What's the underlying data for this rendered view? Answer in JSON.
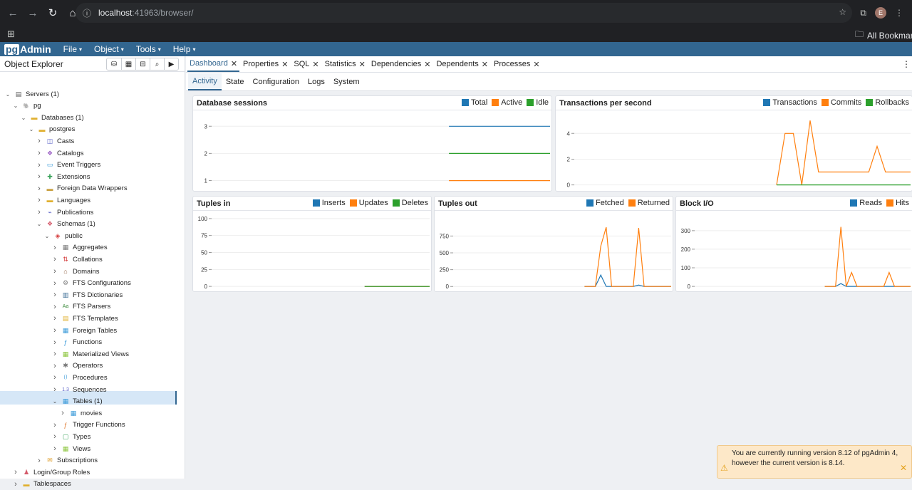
{
  "browser": {
    "url_host": "localhost",
    "url_rest": ":41963/browser/",
    "profile_initial": "E",
    "bookmarks_label": "All Bookmarks"
  },
  "menubar": {
    "logo_pg": "pg",
    "logo_admin": "Admin",
    "items": [
      "File",
      "Object",
      "Tools",
      "Help"
    ]
  },
  "explorer": {
    "title": "Object Explorer",
    "tree": [
      {
        "label": "Servers (1)",
        "level": 0,
        "toggle": "open",
        "icon": "servers-icon",
        "glyph": "▤",
        "color": "#555"
      },
      {
        "label": "pg",
        "level": 1,
        "toggle": "open",
        "icon": "server-elephant-icon",
        "glyph": "🐘",
        "color": "#326690"
      },
      {
        "label": "Databases (1)",
        "level": 2,
        "toggle": "open",
        "icon": "databases-icon",
        "glyph": "▬",
        "color": "#e0b030"
      },
      {
        "label": "postgres",
        "level": 3,
        "toggle": "open",
        "icon": "database-icon",
        "glyph": "▬",
        "color": "#e0b030"
      },
      {
        "label": "Casts",
        "level": 4,
        "toggle": "closed",
        "icon": "casts-icon",
        "glyph": "◫",
        "color": "#5a62c8"
      },
      {
        "label": "Catalogs",
        "level": 4,
        "toggle": "closed",
        "icon": "catalogs-icon",
        "glyph": "❖",
        "color": "#9b5fc4"
      },
      {
        "label": "Event Triggers",
        "level": 4,
        "toggle": "closed",
        "icon": "event-triggers-icon",
        "glyph": "▭",
        "color": "#3a9ad9"
      },
      {
        "label": "Extensions",
        "level": 4,
        "toggle": "closed",
        "icon": "extensions-icon",
        "glyph": "✚",
        "color": "#3aa35a"
      },
      {
        "label": "Foreign Data Wrappers",
        "level": 4,
        "toggle": "closed",
        "icon": "foreign-data-wrappers-icon",
        "glyph": "▬",
        "color": "#c9a040"
      },
      {
        "label": "Languages",
        "level": 4,
        "toggle": "closed",
        "icon": "languages-icon",
        "glyph": "▬",
        "color": "#e0b030"
      },
      {
        "label": "Publications",
        "level": 4,
        "toggle": "closed",
        "icon": "publications-icon",
        "glyph": "⌁",
        "color": "#5a62c8"
      },
      {
        "label": "Schemas (1)",
        "level": 4,
        "toggle": "open",
        "icon": "schemas-icon",
        "glyph": "❖",
        "color": "#d45a6a"
      },
      {
        "label": "public",
        "level": 5,
        "toggle": "open",
        "icon": "schema-public-icon",
        "glyph": "◈",
        "color": "#d43a3a"
      },
      {
        "label": "Aggregates",
        "level": 6,
        "toggle": "closed",
        "icon": "aggregates-icon",
        "glyph": "▦",
        "color": "#777"
      },
      {
        "label": "Collations",
        "level": 6,
        "toggle": "closed",
        "icon": "collations-icon",
        "glyph": "⇅",
        "color": "#d43a3a"
      },
      {
        "label": "Domains",
        "level": 6,
        "toggle": "closed",
        "icon": "domains-icon",
        "glyph": "⌂",
        "color": "#8a5a3a"
      },
      {
        "label": "FTS Configurations",
        "level": 6,
        "toggle": "closed",
        "icon": "fts-configurations-icon",
        "glyph": "⚙",
        "color": "#777"
      },
      {
        "label": "FTS Dictionaries",
        "level": 6,
        "toggle": "closed",
        "icon": "fts-dictionaries-icon",
        "glyph": "▥",
        "color": "#326690"
      },
      {
        "label": "FTS Parsers",
        "level": 6,
        "toggle": "closed",
        "icon": "fts-parsers-icon",
        "glyph": "Aa",
        "color": "#3a8a3a"
      },
      {
        "label": "FTS Templates",
        "level": 6,
        "toggle": "closed",
        "icon": "fts-templates-icon",
        "glyph": "▤",
        "color": "#e0b030"
      },
      {
        "label": "Foreign Tables",
        "level": 6,
        "toggle": "closed",
        "icon": "foreign-tables-icon",
        "glyph": "▦",
        "color": "#3a9ad9"
      },
      {
        "label": "Functions",
        "level": 6,
        "toggle": "closed",
        "icon": "functions-icon",
        "glyph": "ƒ",
        "color": "#3a9ad9"
      },
      {
        "label": "Materialized Views",
        "level": 6,
        "toggle": "closed",
        "icon": "materialized-views-icon",
        "glyph": "▦",
        "color": "#8ac43a"
      },
      {
        "label": "Operators",
        "level": 6,
        "toggle": "closed",
        "icon": "operators-icon",
        "glyph": "✱",
        "color": "#777"
      },
      {
        "label": "Procedures",
        "level": 6,
        "toggle": "closed",
        "icon": "procedures-icon",
        "glyph": "⟮⟯",
        "color": "#3a9ad9"
      },
      {
        "label": "Sequences",
        "level": 6,
        "toggle": "closed",
        "icon": "sequences-icon",
        "glyph": "1.3",
        "color": "#5a62c8"
      },
      {
        "label": "Tables (1)",
        "level": 6,
        "toggle": "open",
        "icon": "tables-icon",
        "glyph": "▦",
        "color": "#3a9ad9"
      },
      {
        "label": "movies",
        "level": 7,
        "toggle": "closed",
        "icon": "table-icon",
        "glyph": "▦",
        "color": "#3a9ad9",
        "selected": true
      },
      {
        "label": "Trigger Functions",
        "level": 6,
        "toggle": "closed",
        "icon": "trigger-functions-icon",
        "glyph": "ƒ",
        "color": "#e07a30"
      },
      {
        "label": "Types",
        "level": 6,
        "toggle": "closed",
        "icon": "types-icon",
        "glyph": "▢",
        "color": "#3aa35a"
      },
      {
        "label": "Views",
        "level": 6,
        "toggle": "closed",
        "icon": "views-icon",
        "glyph": "▦",
        "color": "#8ac43a"
      },
      {
        "label": "Subscriptions",
        "level": 4,
        "toggle": "closed",
        "icon": "subscriptions-icon",
        "glyph": "✉",
        "color": "#e0a030"
      },
      {
        "label": "Login/Group Roles",
        "level": 1,
        "toggle": "closed",
        "icon": "login-group-roles-icon",
        "glyph": "♟",
        "color": "#d45a6a"
      },
      {
        "label": "Tablespaces",
        "level": 1,
        "toggle": "closed",
        "icon": "tablespaces-icon",
        "glyph": "▬",
        "color": "#e0b030"
      }
    ]
  },
  "tabs": [
    "Dashboard",
    "Properties",
    "SQL",
    "Statistics",
    "Dependencies",
    "Dependents",
    "Processes"
  ],
  "active_tab": "Dashboard",
  "subtabs": [
    "Activity",
    "State",
    "Configuration",
    "Logs",
    "System"
  ],
  "active_subtab": "Activity",
  "colors": {
    "blue": "#1f77b4",
    "orange": "#ff7f0e",
    "green": "#2ca02c",
    "accent": "#326690"
  },
  "chart_data": [
    {
      "id": "database-sessions",
      "type": "line",
      "title": "Database sessions",
      "ylim": [
        0.7,
        3.4
      ],
      "yticks": [
        1,
        2,
        3
      ],
      "x": [
        0,
        1,
        2,
        3,
        4,
        5,
        6,
        7,
        8,
        9,
        10,
        11,
        12,
        13,
        14,
        15,
        16,
        17,
        18,
        19,
        20
      ],
      "series": [
        {
          "name": "Total",
          "color": "blue",
          "values": [
            null,
            null,
            null,
            null,
            null,
            null,
            null,
            null,
            null,
            null,
            null,
            null,
            null,
            null,
            3,
            3,
            3,
            3,
            3,
            3,
            3
          ]
        },
        {
          "name": "Active",
          "color": "orange",
          "values": [
            null,
            null,
            null,
            null,
            null,
            null,
            null,
            null,
            null,
            null,
            null,
            null,
            null,
            null,
            1,
            1,
            1,
            1,
            1,
            1,
            1
          ]
        },
        {
          "name": "Idle",
          "color": "green",
          "values": [
            null,
            null,
            null,
            null,
            null,
            null,
            null,
            null,
            null,
            null,
            null,
            null,
            null,
            null,
            2,
            2,
            2,
            2,
            2,
            2,
            2
          ]
        }
      ]
    },
    {
      "id": "transactions-per-second",
      "type": "line",
      "title": "Transactions per second",
      "ylim": [
        -0.3,
        5.4
      ],
      "yticks": [
        0,
        2,
        4
      ],
      "x": [
        0,
        1,
        2,
        3,
        4,
        5,
        6,
        7,
        8,
        9,
        10,
        11,
        12,
        13,
        14,
        15,
        16,
        17,
        18,
        19,
        20,
        21,
        22,
        23,
        24,
        25,
        26,
        27,
        28,
        29,
        30,
        31,
        32,
        33,
        34,
        35,
        36,
        37,
        38,
        39,
        40
      ],
      "series": [
        {
          "name": "Transactions",
          "color": "blue",
          "values": [
            null,
            null,
            null,
            null,
            null,
            null,
            null,
            null,
            null,
            null,
            null,
            null,
            null,
            null,
            null,
            null,
            null,
            null,
            null,
            null,
            null,
            null,
            null,
            null,
            null,
            null,
            null,
            null,
            null,
            null,
            null,
            null,
            null,
            null,
            null,
            null,
            null,
            null,
            null,
            null,
            null
          ]
        },
        {
          "name": "Commits",
          "color": "orange",
          "values": [
            null,
            null,
            null,
            null,
            null,
            null,
            null,
            null,
            null,
            null,
            null,
            null,
            null,
            null,
            null,
            null,
            null,
            null,
            null,
            null,
            null,
            null,
            null,
            null,
            0,
            4,
            4,
            0,
            5,
            1,
            1,
            1,
            1,
            1,
            1,
            1,
            3,
            1,
            1,
            1,
            1
          ]
        },
        {
          "name": "Rollbacks",
          "color": "green",
          "values": [
            null,
            null,
            null,
            null,
            null,
            null,
            null,
            null,
            null,
            null,
            null,
            null,
            null,
            null,
            null,
            null,
            null,
            null,
            null,
            null,
            null,
            null,
            null,
            null,
            0,
            0,
            0,
            0,
            0,
            0,
            0,
            0,
            0,
            0,
            0,
            0,
            0,
            0,
            0,
            0,
            0
          ]
        }
      ]
    },
    {
      "id": "tuples-in",
      "type": "line",
      "title": "Tuples in",
      "ylim": [
        -4,
        104
      ],
      "yticks": [
        0,
        25,
        50,
        75,
        100
      ],
      "x": [
        0,
        1,
        2,
        3,
        4,
        5,
        6,
        7,
        8,
        9,
        10,
        11,
        12,
        13,
        14,
        15,
        16,
        17,
        18,
        19,
        20
      ],
      "series": [
        {
          "name": "Inserts",
          "color": "blue",
          "values": [
            null,
            null,
            null,
            null,
            null,
            null,
            null,
            null,
            null,
            null,
            null,
            null,
            null,
            null,
            0,
            0,
            0,
            0,
            0,
            0,
            0
          ]
        },
        {
          "name": "Updates",
          "color": "orange",
          "values": [
            null,
            null,
            null,
            null,
            null,
            null,
            null,
            null,
            null,
            null,
            null,
            null,
            null,
            null,
            0,
            0,
            0,
            0,
            0,
            0,
            0
          ]
        },
        {
          "name": "Deletes",
          "color": "green",
          "values": [
            null,
            null,
            null,
            null,
            null,
            null,
            null,
            null,
            null,
            null,
            null,
            null,
            null,
            null,
            0,
            0,
            0,
            0,
            0,
            0,
            0
          ]
        }
      ]
    },
    {
      "id": "tuples-out",
      "type": "line",
      "title": "Tuples out",
      "ylim": [
        -40,
        1050
      ],
      "yticks": [
        0,
        250,
        500,
        750
      ],
      "x": [
        0,
        1,
        2,
        3,
        4,
        5,
        6,
        7,
        8,
        9,
        10,
        11,
        12,
        13,
        14,
        15,
        16,
        17,
        18,
        19,
        20,
        21,
        22,
        23,
        24,
        25,
        26,
        27,
        28,
        29,
        30,
        31,
        32,
        33,
        34,
        35,
        36,
        37,
        38,
        39,
        40
      ],
      "series": [
        {
          "name": "Fetched",
          "color": "blue",
          "values": [
            null,
            null,
            null,
            null,
            null,
            null,
            null,
            null,
            null,
            null,
            null,
            null,
            null,
            null,
            null,
            null,
            null,
            null,
            null,
            null,
            null,
            null,
            null,
            null,
            0,
            0,
            0,
            170,
            0,
            0,
            0,
            0,
            0,
            0,
            20,
            0,
            0,
            0,
            0,
            0,
            0
          ]
        },
        {
          "name": "Returned",
          "color": "orange",
          "values": [
            null,
            null,
            null,
            null,
            null,
            null,
            null,
            null,
            null,
            null,
            null,
            null,
            null,
            null,
            null,
            null,
            null,
            null,
            null,
            null,
            null,
            null,
            null,
            null,
            0,
            0,
            0,
            600,
            880,
            0,
            0,
            0,
            0,
            0,
            870,
            0,
            0,
            0,
            0,
            0,
            0
          ]
        }
      ]
    },
    {
      "id": "block-io",
      "type": "line",
      "title": "Block I/O",
      "ylim": [
        -15,
        380
      ],
      "yticks": [
        0,
        100,
        200,
        300
      ],
      "x": [
        0,
        1,
        2,
        3,
        4,
        5,
        6,
        7,
        8,
        9,
        10,
        11,
        12,
        13,
        14,
        15,
        16,
        17,
        18,
        19,
        20,
        21,
        22,
        23,
        24,
        25,
        26,
        27,
        28,
        29,
        30,
        31,
        32,
        33,
        34,
        35,
        36,
        37,
        38,
        39,
        40
      ],
      "series": [
        {
          "name": "Reads",
          "color": "blue",
          "values": [
            null,
            null,
            null,
            null,
            null,
            null,
            null,
            null,
            null,
            null,
            null,
            null,
            null,
            null,
            null,
            null,
            null,
            null,
            null,
            null,
            null,
            null,
            null,
            null,
            0,
            0,
            0,
            15,
            0,
            0,
            0,
            0,
            0,
            0,
            0,
            0,
            0,
            0,
            0,
            0,
            0
          ]
        },
        {
          "name": "Hits",
          "color": "orange",
          "values": [
            null,
            null,
            null,
            null,
            null,
            null,
            null,
            null,
            null,
            null,
            null,
            null,
            null,
            null,
            null,
            null,
            null,
            null,
            null,
            null,
            null,
            null,
            null,
            null,
            0,
            0,
            0,
            320,
            0,
            75,
            0,
            0,
            0,
            0,
            0,
            0,
            75,
            0,
            0,
            0,
            0
          ]
        }
      ]
    }
  ],
  "notification": {
    "message": "You are currently running version 8.12 of pgAdmin 4, however the current version is 8.14."
  }
}
